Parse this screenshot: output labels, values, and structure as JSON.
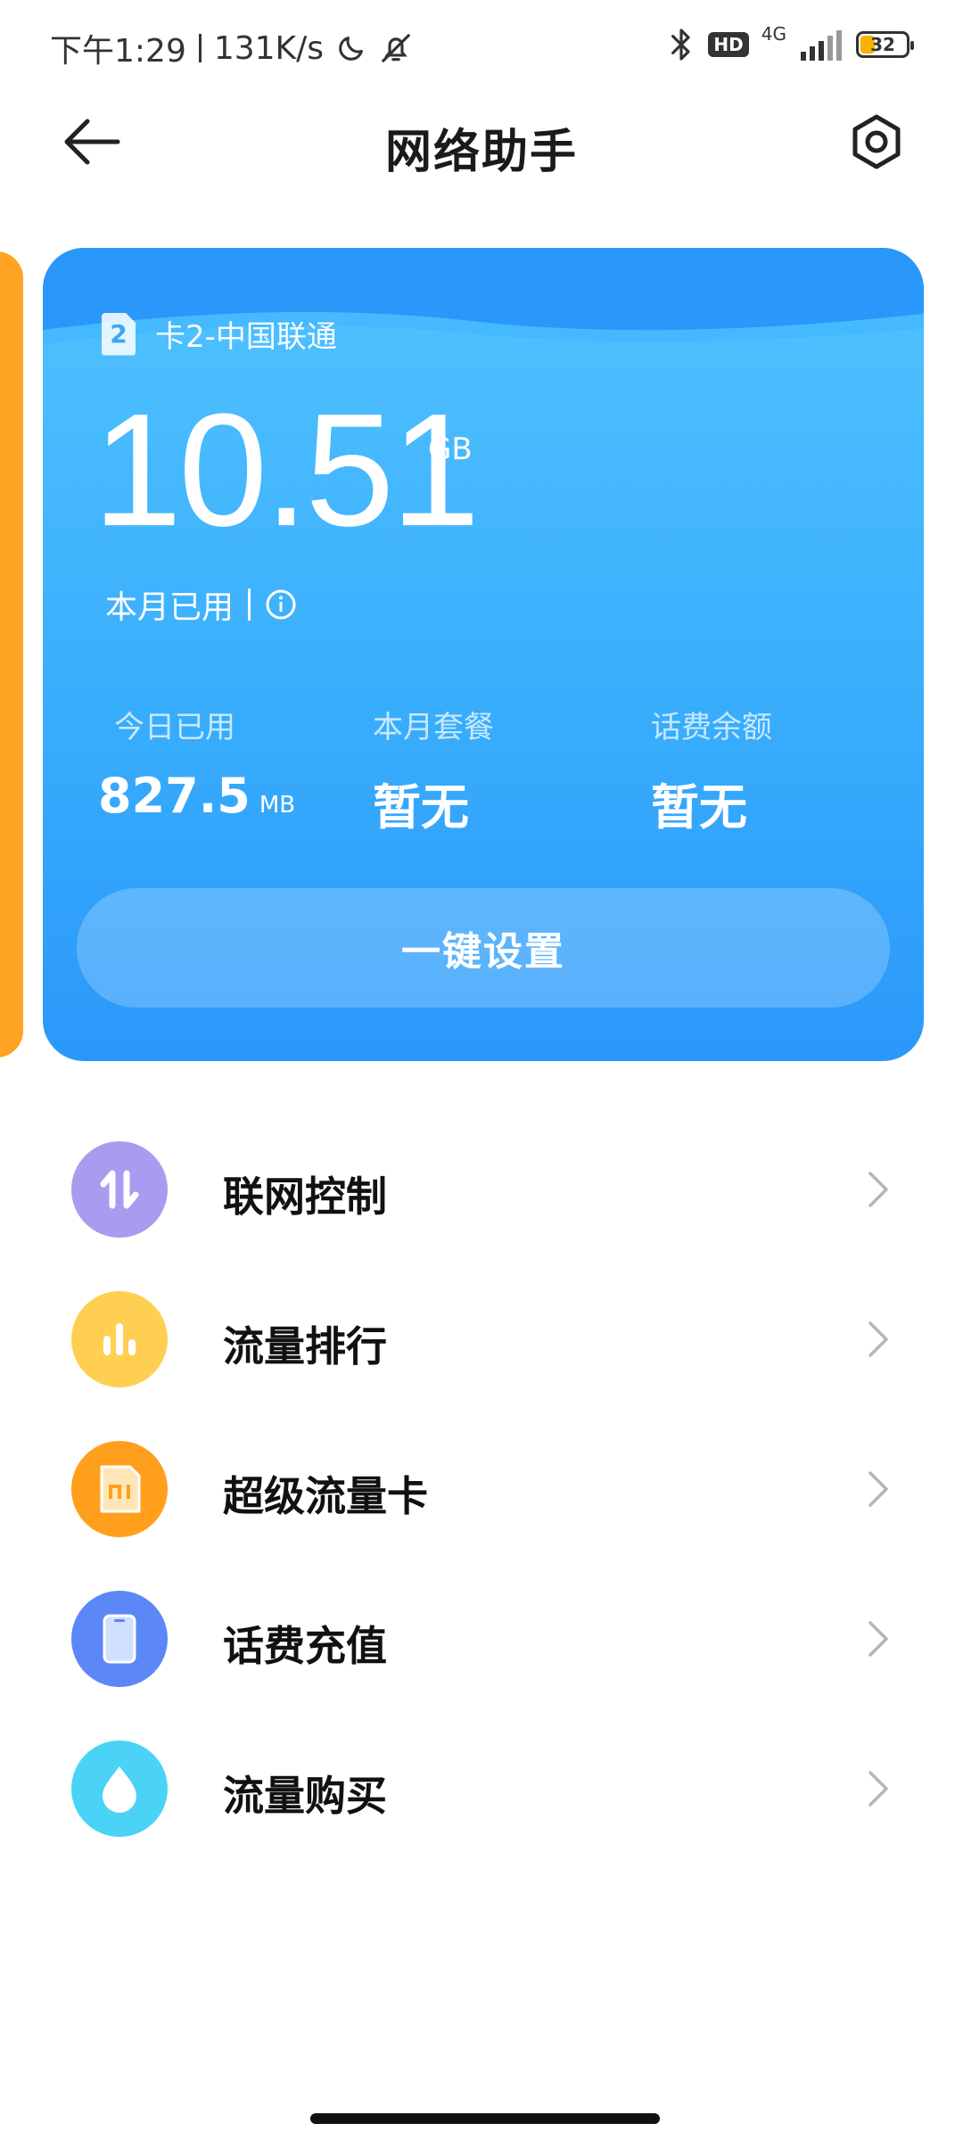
{
  "status_bar": {
    "time": "下午1:29",
    "speed": "131K/s",
    "hd_label": "HD",
    "network_type": "4G",
    "battery": "32"
  },
  "header": {
    "title": "网络助手"
  },
  "card": {
    "sim_number": "2",
    "sim_label": "卡2-中国联通",
    "usage_value": "10.51",
    "usage_unit": "GB",
    "usage_caption": "本月已用",
    "stats": [
      {
        "label": "今日已用",
        "value": "827.5",
        "unit": "MB"
      },
      {
        "label": "本月套餐",
        "value": "暂无"
      },
      {
        "label": "话费余额",
        "value": "暂无"
      }
    ],
    "button_label": "一键设置"
  },
  "menu": {
    "items": [
      {
        "label": "联网控制",
        "icon": "network-control-icon",
        "color": "#a79cf0"
      },
      {
        "label": "流量排行",
        "icon": "bar-chart-icon",
        "color": "#ffcf52"
      },
      {
        "label": "超级流量卡",
        "icon": "mi-sim-card-icon",
        "color": "#ff9f1c"
      },
      {
        "label": "话费充值",
        "icon": "phone-icon",
        "color": "#5b87f7"
      },
      {
        "label": "流量购买",
        "icon": "water-drop-icon",
        "color": "#4ad3f7"
      }
    ]
  },
  "colors": {
    "card_top": "#52c3ff",
    "card_bottom": "#2a98fa",
    "side_card": "#ffa323"
  }
}
